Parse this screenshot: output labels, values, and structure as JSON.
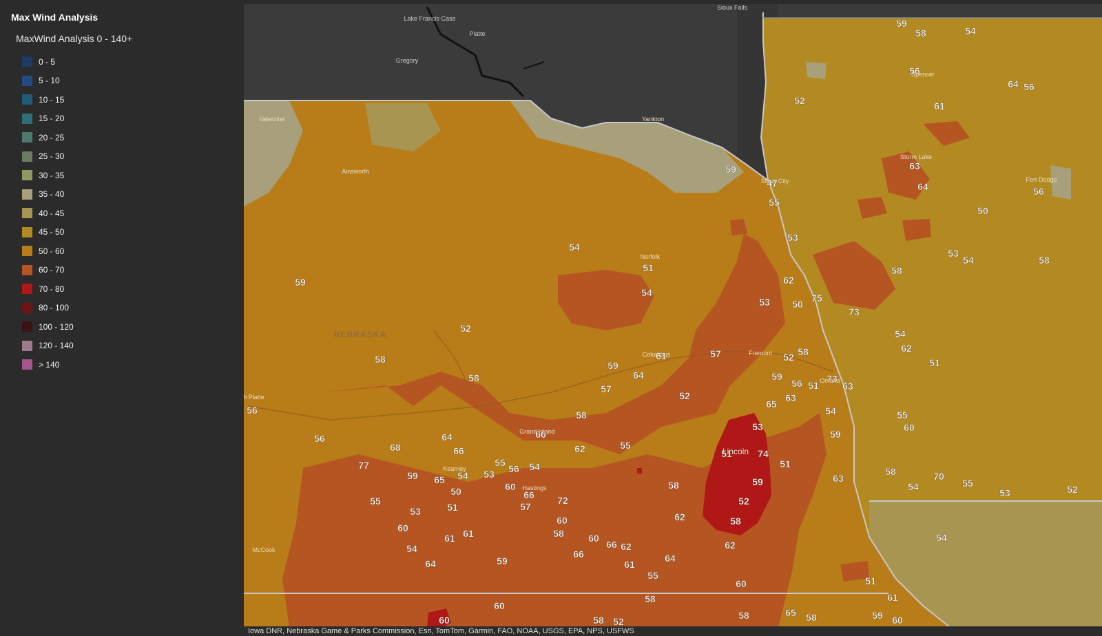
{
  "legend": {
    "title": "Max Wind Analysis",
    "subtitle": "MaxWind Analysis 0 - 140+",
    "items": [
      {
        "label": "0 - 5",
        "color": "#1f3b63"
      },
      {
        "label": "5 - 10",
        "color": "#234a84"
      },
      {
        "label": "10 - 15",
        "color": "#1d5d78"
      },
      {
        "label": "15 - 20",
        "color": "#2d6f78"
      },
      {
        "label": "20 - 25",
        "color": "#4d7a6e"
      },
      {
        "label": "25 - 30",
        "color": "#6a7d62"
      },
      {
        "label": "30 - 35",
        "color": "#8f9a62"
      },
      {
        "label": "35 - 40",
        "color": "#a8a07a"
      },
      {
        "label": "40 - 45",
        "color": "#a99552"
      },
      {
        "label": "45 - 50",
        "color": "#b38a22"
      },
      {
        "label": "50 - 60",
        "color": "#b87d18"
      },
      {
        "label": "60 - 70",
        "color": "#b55522"
      },
      {
        "label": "70 - 80",
        "color": "#b01818"
      },
      {
        "label": "80 - 100",
        "color": "#6e1414"
      },
      {
        "label": "100 - 120",
        "color": "#3d1212"
      },
      {
        "label": "120 - 140",
        "color": "#9c7a8c"
      },
      {
        "label": "> 140",
        "color": "#a4558e"
      }
    ]
  },
  "map": {
    "places": [
      "Sioux Falls",
      "Lake Francis Case",
      "Platte",
      "Gregory",
      "Valentine",
      "Ainsworth",
      "Yankton",
      "Sioux City",
      "Norfolk",
      "NEBRASKA",
      "North Platte",
      "Columbus",
      "Fremont",
      "Omaha",
      "Lincoln",
      "Grand Island",
      "Kearney",
      "Hastings",
      "McCook",
      "Spencer",
      "Storm Lake",
      "Fort Dodge"
    ],
    "values": [
      "59",
      "58",
      "54",
      "56",
      "64",
      "56",
      "52",
      "61",
      "63",
      "64",
      "56",
      "50",
      "59",
      "47",
      "55",
      "53",
      "54",
      "51",
      "54",
      "53",
      "54",
      "58",
      "62",
      "53",
      "50",
      "75",
      "58",
      "73",
      "52",
      "54",
      "62",
      "51",
      "59",
      "58",
      "58",
      "61",
      "57",
      "52",
      "58",
      "59",
      "64",
      "57",
      "59",
      "56",
      "51",
      "73",
      "63",
      "52",
      "63",
      "65",
      "54",
      "55",
      "60",
      "56",
      "58",
      "56",
      "66",
      "64",
      "66",
      "68",
      "55",
      "62",
      "53",
      "59",
      "51",
      "74",
      "51",
      "77",
      "55",
      "56",
      "54",
      "58",
      "59",
      "65",
      "54",
      "53",
      "60",
      "66",
      "58",
      "59",
      "63",
      "54",
      "70",
      "55",
      "53",
      "52",
      "55",
      "50",
      "72",
      "52",
      "53",
      "51",
      "57",
      "60",
      "62",
      "58",
      "60",
      "61",
      "61",
      "58",
      "60",
      "66",
      "62",
      "62",
      "54",
      "54",
      "64",
      "59",
      "66",
      "61",
      "64",
      "55",
      "60",
      "51",
      "61",
      "58",
      "60",
      "58",
      "65",
      "58",
      "59",
      "60",
      "60",
      "58",
      "52",
      "70",
      "55",
      "62"
    ]
  },
  "attribution": "Iowa DNR, Nebraska Game & Parks Commission, Esri, TomTom, Garmin, FAO, NOAA, USGS, EPA, NPS, USFWS"
}
